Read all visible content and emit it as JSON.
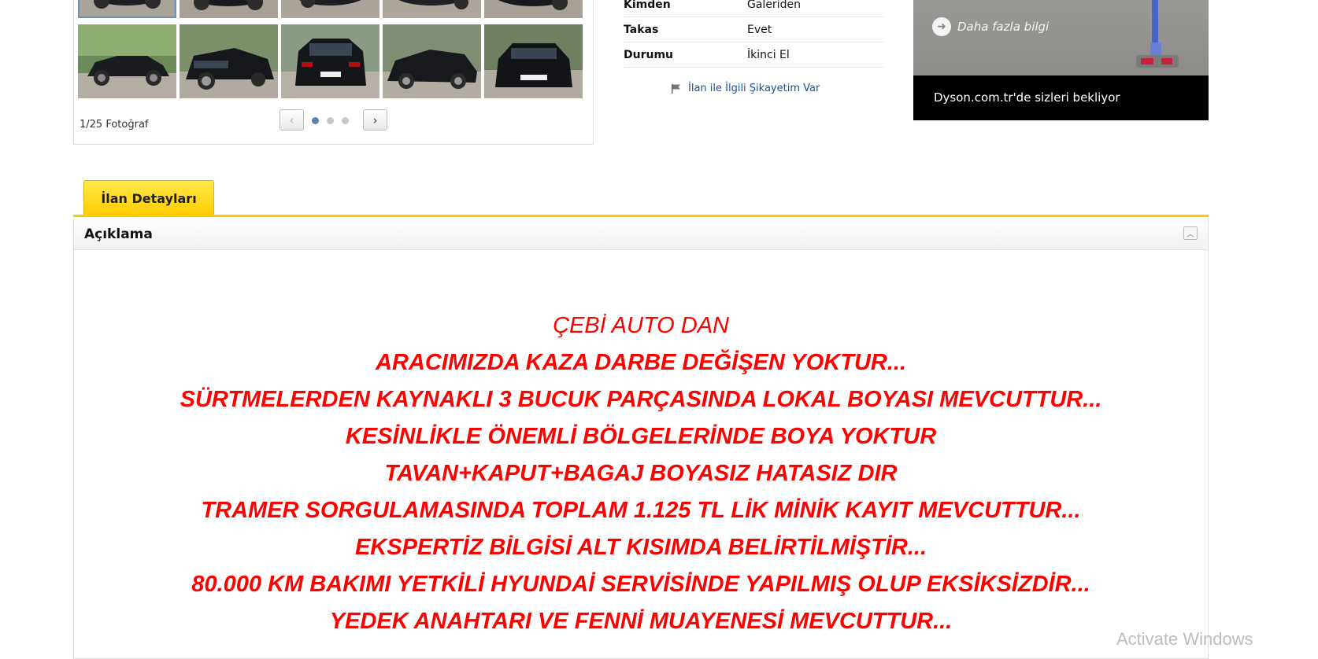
{
  "gallery": {
    "photo_count": "1/25 Fotoğraf",
    "prev_label": "‹",
    "next_label": "›",
    "pages": 3,
    "active_page": 1
  },
  "info": {
    "rows": [
      {
        "key": "Kimden",
        "value": "Galeriden"
      },
      {
        "key": "Takas",
        "value": "Evet"
      },
      {
        "key": "Durumu",
        "value": "İkinci El"
      }
    ],
    "complaint_link": "İlan ile İlgili Şikayetim Var"
  },
  "ad": {
    "more_info": "Daha fazla bilgi",
    "tagline": "Dyson.com.tr'de sizleri bekliyor"
  },
  "tabs": [
    {
      "label": "İlan Detayları",
      "active": true
    }
  ],
  "description": {
    "title": "Açıklama",
    "lines": [
      "ÇEBİ AUTO DAN",
      "ARACIMIZDA KAZA DARBE DEĞİŞEN YOKTUR...",
      "SÜRTMELERDEN KAYNAKLI 3 BUCUK PARÇASINDA LOKAL BOYASI MEVCUTTUR...",
      "KESİNLİKLE ÖNEMLİ BÖLGELERİNDE BOYA YOKTUR",
      "TAVAN+KAPUT+BAGAJ BOYASIZ HATASIZ DIR",
      "TRAMER SORGULAMASINDA  TOPLAM 1.125 TL LİK  MİNİK KAYIT MEVCUTTUR...",
      "EKSPERTİZ BİLGİSİ  ALT KISIMDA BELİRTİLMİŞTİR...",
      "80.000 KM BAKIMI YETKİLİ HYUNDAİ SERVİSİNDE YAPILMIŞ OLUP EKSİKSİZDİR...",
      "YEDEK ANAHTARI VE FENNİ MUAYENESİ MEVCUTTUR..."
    ]
  },
  "system": {
    "watermark": "Activate Windows"
  }
}
